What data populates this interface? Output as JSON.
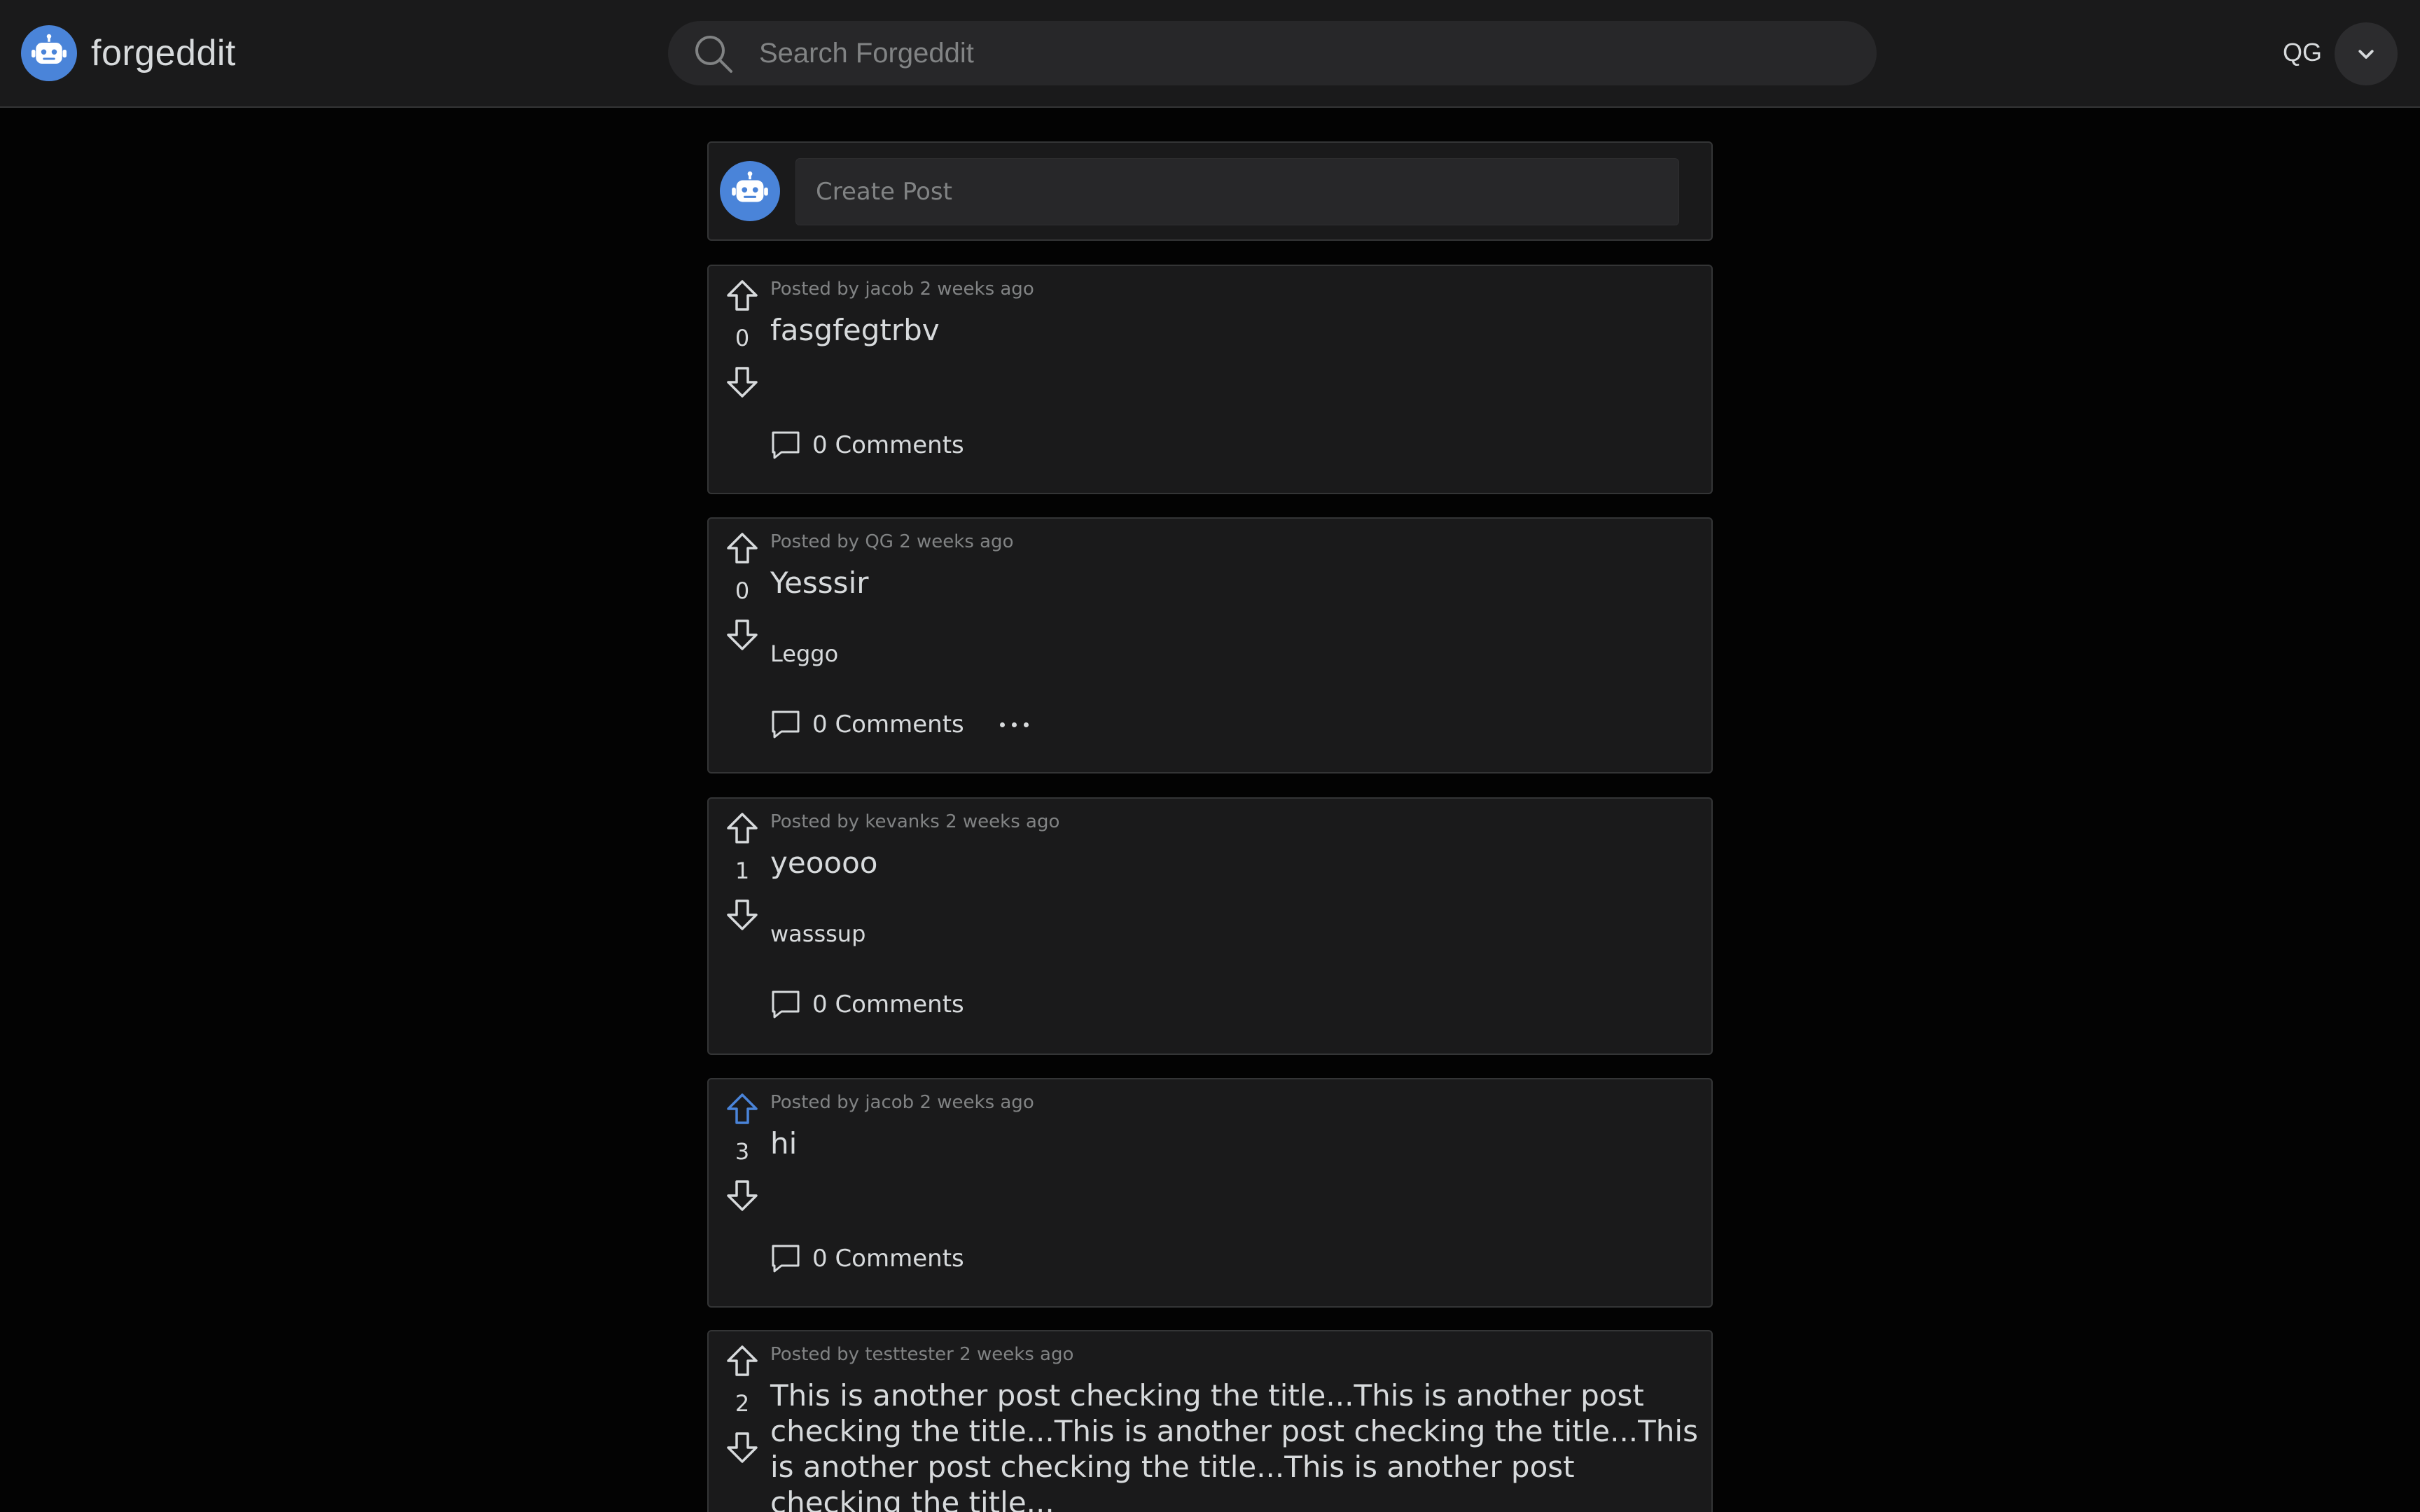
{
  "app": {
    "brand_name": "forgeddit",
    "logo_icon": "robot-icon",
    "accent_color": "#4a84d9"
  },
  "search": {
    "placeholder": "Search Forgeddit",
    "value": ""
  },
  "user": {
    "name": "QG",
    "menu_icon": "chevron-down-icon"
  },
  "create_post": {
    "placeholder": "Create Post"
  },
  "posts": [
    {
      "meta": "Posted by jacob 2 weeks ago",
      "title": "fasgfegtrbv",
      "body": "",
      "votes": "0",
      "upvoted": false,
      "comments": "0 Comments",
      "has_more_menu": false
    },
    {
      "meta": "Posted by QG 2 weeks ago",
      "title": "Yesssir",
      "body": "Leggo",
      "votes": "0",
      "upvoted": false,
      "comments": "0 Comments",
      "has_more_menu": true
    },
    {
      "meta": "Posted by kevanks 2 weeks ago",
      "title": "yeoooo",
      "body": "wasssup",
      "votes": "1",
      "upvoted": false,
      "comments": "0 Comments",
      "has_more_menu": false
    },
    {
      "meta": "Posted by jacob 2 weeks ago",
      "title": "hi",
      "body": "",
      "votes": "3",
      "upvoted": true,
      "comments": "0 Comments",
      "has_more_menu": false
    },
    {
      "meta": "Posted by testtester 2 weeks ago",
      "title": "This is another post checking the title...This is another post checking the title...This is another post checking the title...This is another post checking the title...This is another post checking the title...",
      "body": "",
      "votes": "2",
      "upvoted": false,
      "comments": "",
      "has_more_menu": false
    }
  ]
}
